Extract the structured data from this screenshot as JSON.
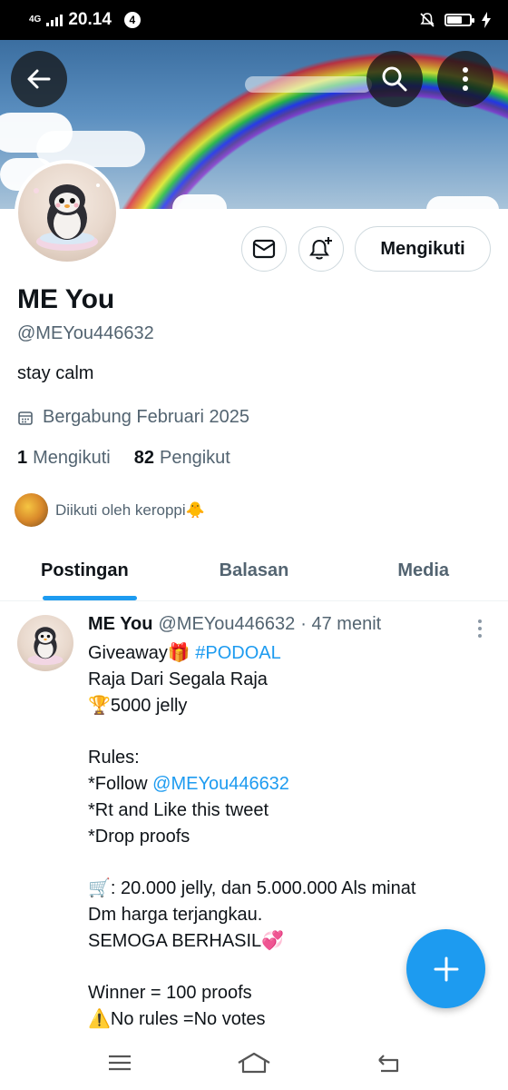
{
  "status_bar": {
    "network": "4G",
    "time": "20.14",
    "notification_count": "4",
    "icons": [
      "signal-icon",
      "mute-icon",
      "battery-icon",
      "charging-icon"
    ],
    "battery_level": 0.65
  },
  "header": {
    "back_icon": "arrow-left-icon",
    "search_icon": "search-icon",
    "more_icon": "more-vertical-icon"
  },
  "profile": {
    "name": "ME You",
    "handle": "@MEYou446632",
    "bio": "stay calm",
    "joined": "Bergabung Februari 2025",
    "following_count": "1",
    "following_label": "Mengikuti",
    "followers_count": "82",
    "followers_label": "Pengikut",
    "followed_by": "Diikuti oleh keroppi🐥",
    "follow_button": "Mengikuti"
  },
  "tabs": [
    {
      "label": "Postingan",
      "active": true
    },
    {
      "label": "Balasan",
      "active": false
    },
    {
      "label": "Media",
      "active": false
    }
  ],
  "tweet": {
    "author": "ME You",
    "handle": "@MEYou446632",
    "time": "· 47 menit",
    "line1_text": "Giveaway🎁 ",
    "line1_hashtag": "#PODOAL",
    "line2": "Raja Dari Segala Raja",
    "line3": "🏆5000 jelly",
    "line5": "Rules:",
    "line6_prefix": "*Follow ",
    "line6_mention": "@MEYou446632",
    "line7": "*Rt and Like this tweet",
    "line8": "*Drop proofs",
    "line10": "🛒: 20.000 jelly, dan 5.000.000 Als minat",
    "line11": "Dm harga terjangkau.",
    "line12": "SEMOGA BERHASIL💞",
    "line14": "Winner = 100 proofs",
    "line15": "⚠️No rules =No votes"
  },
  "colors": {
    "accent": "#1d9bf0",
    "text_primary": "#0f1419",
    "text_secondary": "#536471",
    "border": "#cfd9de"
  }
}
